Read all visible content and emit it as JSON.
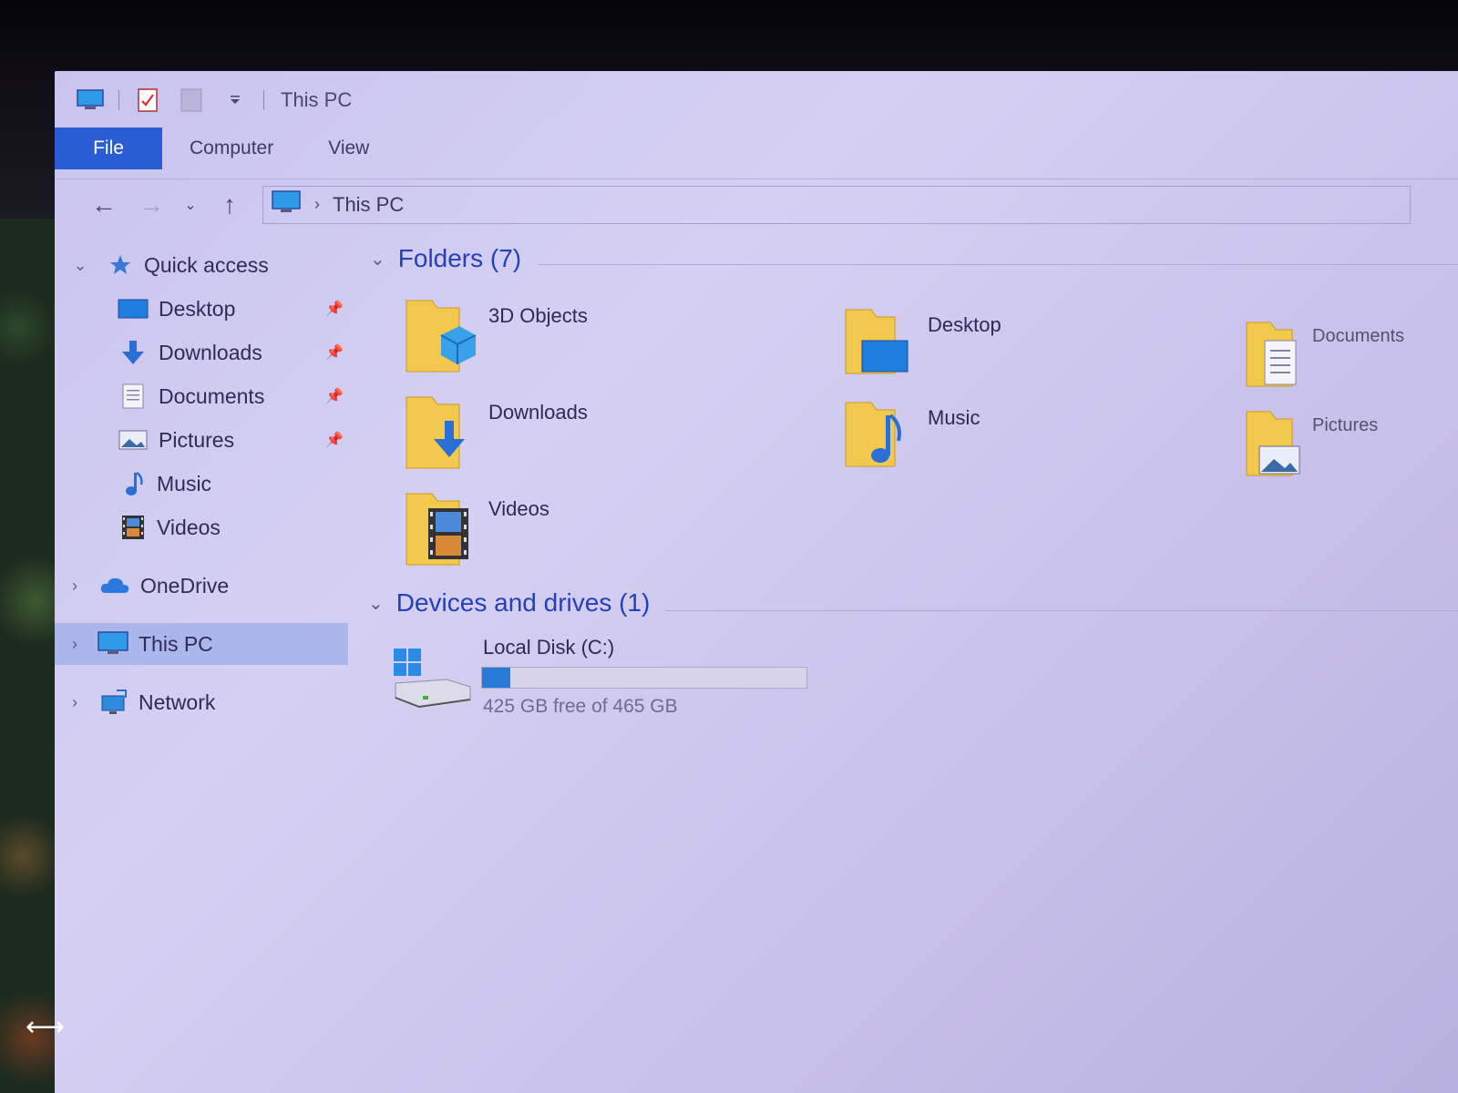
{
  "window": {
    "title": "This PC"
  },
  "ribbon": {
    "tabs": [
      {
        "label": "File",
        "active": true
      },
      {
        "label": "Computer",
        "active": false
      },
      {
        "label": "View",
        "active": false
      }
    ]
  },
  "address": {
    "path": [
      "This PC"
    ]
  },
  "sidebar": {
    "items": [
      {
        "label": "Quick access",
        "icon": "star-icon",
        "expanded": true
      },
      {
        "label": "Desktop",
        "icon": "desktop-icon",
        "pinned": true
      },
      {
        "label": "Downloads",
        "icon": "download-arrow-icon",
        "pinned": true
      },
      {
        "label": "Documents",
        "icon": "document-icon",
        "pinned": true
      },
      {
        "label": "Pictures",
        "icon": "pictures-icon",
        "pinned": true
      },
      {
        "label": "Music",
        "icon": "music-note-icon",
        "pinned": false
      },
      {
        "label": "Videos",
        "icon": "film-icon",
        "pinned": false
      },
      {
        "label": "OneDrive",
        "icon": "cloud-icon",
        "expanded": false
      },
      {
        "label": "This PC",
        "icon": "computer-icon",
        "expanded": false,
        "selected": true
      },
      {
        "label": "Network",
        "icon": "network-icon",
        "expanded": false
      }
    ]
  },
  "content": {
    "folders_header": "Folders (7)",
    "folders": [
      {
        "name": "3D Objects",
        "icon": "3d-objects-folder-icon"
      },
      {
        "name": "Desktop",
        "icon": "desktop-folder-icon"
      },
      {
        "name": "Documents",
        "icon": "documents-folder-icon"
      },
      {
        "name": "Downloads",
        "icon": "downloads-folder-icon"
      },
      {
        "name": "Music",
        "icon": "music-folder-icon"
      },
      {
        "name": "Pictures",
        "icon": "pictures-folder-icon"
      },
      {
        "name": "Videos",
        "icon": "videos-folder-icon"
      }
    ],
    "drives_header": "Devices and drives (1)",
    "drives": [
      {
        "name": "Local Disk (C:)",
        "free_text": "425 GB free of 465 GB",
        "used_fraction": 0.086
      }
    ]
  },
  "colors": {
    "accent": "#2a5cd6",
    "header_text": "#2540b8",
    "selection": "#aab6ec",
    "folder": "#f2c94c",
    "drive_fill": "#2a7ad8"
  }
}
